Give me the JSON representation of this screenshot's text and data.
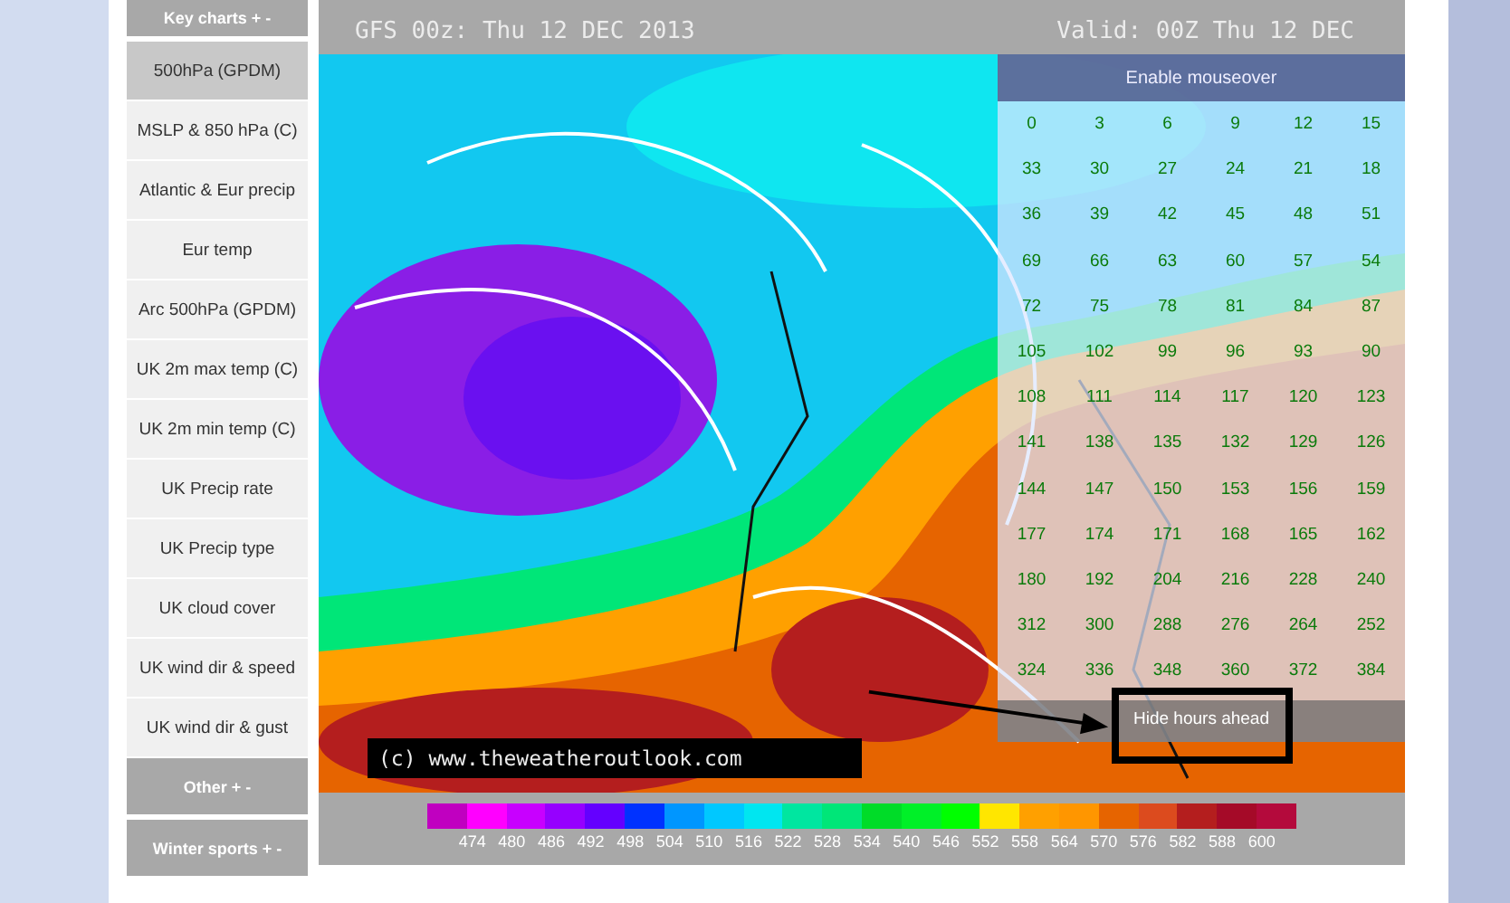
{
  "sidebar": {
    "items": [
      {
        "kind": "section",
        "label": "Key charts + -",
        "selected": false
      },
      {
        "kind": "link",
        "label": "500hPa (GPDM)",
        "selected": true
      },
      {
        "kind": "link",
        "label": "MSLP & 850 hPa (C)",
        "selected": false
      },
      {
        "kind": "link",
        "label": "Atlantic & Eur precip",
        "selected": false
      },
      {
        "kind": "link",
        "label": "Eur temp",
        "selected": false
      },
      {
        "kind": "link",
        "label": "Arc 500hPa (GPDM)",
        "selected": false
      },
      {
        "kind": "link",
        "label": "UK 2m max temp (C)",
        "selected": false
      },
      {
        "kind": "link",
        "label": "UK 2m min temp (C)",
        "selected": false
      },
      {
        "kind": "link",
        "label": "UK Precip rate",
        "selected": false
      },
      {
        "kind": "link",
        "label": "UK Precip type",
        "selected": false
      },
      {
        "kind": "link",
        "label": "UK cloud cover",
        "selected": false
      },
      {
        "kind": "link",
        "label": "UK wind dir & speed",
        "selected": false
      },
      {
        "kind": "link",
        "label": "UK wind dir & gust",
        "selected": false
      },
      {
        "kind": "section",
        "label": "Other + -",
        "selected": false
      },
      {
        "kind": "section",
        "label": "Winter sports + -",
        "selected": false
      }
    ]
  },
  "chart": {
    "run": "GFS 00z: Thu 12 DEC 2013",
    "valid": "Valid: 00Z Thu 12 DEC",
    "copyright": "(c) www.theweatheroutlook.com",
    "hours_panel": {
      "toggle": "Enable mouseover",
      "hide": "Hide hours ahead",
      "rows": [
        [
          "0",
          "3",
          "6",
          "9",
          "12",
          "15"
        ],
        [
          "33",
          "30",
          "27",
          "24",
          "21",
          "18"
        ],
        [
          "36",
          "39",
          "42",
          "45",
          "48",
          "51"
        ],
        [
          "69",
          "66",
          "63",
          "60",
          "57",
          "54"
        ],
        [
          "72",
          "75",
          "78",
          "81",
          "84",
          "87"
        ],
        [
          "105",
          "102",
          "99",
          "96",
          "93",
          "90"
        ],
        [
          "108",
          "111",
          "114",
          "117",
          "120",
          "123"
        ],
        [
          "141",
          "138",
          "135",
          "132",
          "129",
          "126"
        ],
        [
          "144",
          "147",
          "150",
          "153",
          "156",
          "159"
        ],
        [
          "177",
          "174",
          "171",
          "168",
          "165",
          "162"
        ],
        [
          "180",
          "192",
          "204",
          "216",
          "228",
          "240"
        ],
        [
          "312",
          "300",
          "288",
          "276",
          "264",
          "252"
        ],
        [
          "324",
          "336",
          "348",
          "360",
          "372",
          "384"
        ]
      ]
    },
    "scale": {
      "colors": [
        {
          "color": "#c000c0"
        },
        {
          "color": "#ff00ff"
        },
        {
          "color": "#c800ff"
        },
        {
          "color": "#9600ff"
        },
        {
          "color": "#6400ff"
        },
        {
          "color": "#0032ff"
        },
        {
          "color": "#0096ff"
        },
        {
          "color": "#00c8ff"
        },
        {
          "color": "#00e6f0"
        },
        {
          "color": "#00e6a0"
        },
        {
          "color": "#00e678"
        },
        {
          "color": "#00dc28"
        },
        {
          "color": "#00f028"
        },
        {
          "color": "#00ff00"
        },
        {
          "color": "#ffe600"
        },
        {
          "color": "#ffa000"
        },
        {
          "color": "#ff9600"
        },
        {
          "color": "#e66400"
        },
        {
          "color": "#dc4b1e"
        },
        {
          "color": "#b41e1e"
        },
        {
          "color": "#a50a28"
        },
        {
          "color": "#b40a3c"
        }
      ],
      "labels": [
        "474",
        "480",
        "486",
        "492",
        "498",
        "504",
        "510",
        "516",
        "522",
        "528",
        "534",
        "540",
        "546",
        "552",
        "558",
        "564",
        "570",
        "576",
        "582",
        "588",
        "600"
      ]
    }
  }
}
